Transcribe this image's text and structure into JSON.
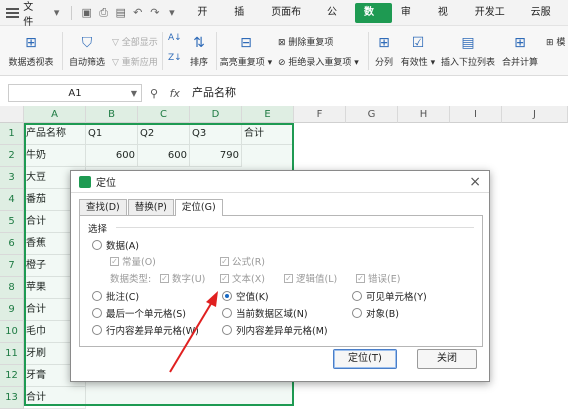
{
  "menubar": {
    "file": "文件",
    "tabs": [
      "开始",
      "插入",
      "页面布局",
      "公式",
      "数据",
      "审阅",
      "视图",
      "开发工具",
      "云服务"
    ],
    "active_tab": "数据"
  },
  "ribbon": {
    "pivot": "数据透视表",
    "autofilter": "自动筛选",
    "show_all": "全部显示",
    "reapply": "重新应用",
    "sort": "排序",
    "highlight_dup": "高亮重复项",
    "delete_dup": "删除重复项",
    "reject_dup": "拒绝录入重复项",
    "split": "分列",
    "validity": "有效性",
    "insert_dropdown": "插入下拉列表",
    "consolidate": "合并计算",
    "more": "模"
  },
  "formula_bar": {
    "name_box": "A1",
    "fx": "fx",
    "content": "产品名称"
  },
  "sheet": {
    "columns": [
      "A",
      "B",
      "C",
      "D",
      "E",
      "F",
      "G",
      "H",
      "I",
      "J"
    ],
    "rows": [
      "1",
      "2",
      "3",
      "4",
      "5",
      "6",
      "7",
      "8",
      "9",
      "10",
      "11",
      "12",
      "13"
    ],
    "row1": [
      "产品名称",
      "Q1",
      "Q2",
      "Q3",
      "合计"
    ],
    "row2": [
      "牛奶",
      "600",
      "600",
      "790"
    ],
    "col_a": [
      "大豆",
      "番茄",
      "合计",
      "香蕉",
      "橙子",
      "苹果",
      "合计",
      "毛巾",
      "牙刷",
      "牙膏",
      "合计"
    ]
  },
  "dialog": {
    "title": "定位",
    "tabs": [
      "查找(D)",
      "替换(P)",
      "定位(G)"
    ],
    "active_tab": "定位(G)",
    "group": "选择",
    "options": {
      "data": "数据(A)",
      "constant": "常量(O)",
      "formula": "公式(R)",
      "data_type": "数据类型:",
      "number": "数字(U)",
      "text": "文本(X)",
      "logical": "逻辑值(L)",
      "error": "错误(E)",
      "comment": "批注(C)",
      "blank": "空值(K)",
      "visible": "可见单元格(Y)",
      "last_cell": "最后一个单元格(S)",
      "current_region": "当前数据区域(N)",
      "object": "对象(B)",
      "row_diff": "行内容差异单元格(W)",
      "col_diff": "列内容差异单元格(M)"
    },
    "selected_option": "空值(K)",
    "goto_button": "定位(T)",
    "close_button": "关闭"
  }
}
